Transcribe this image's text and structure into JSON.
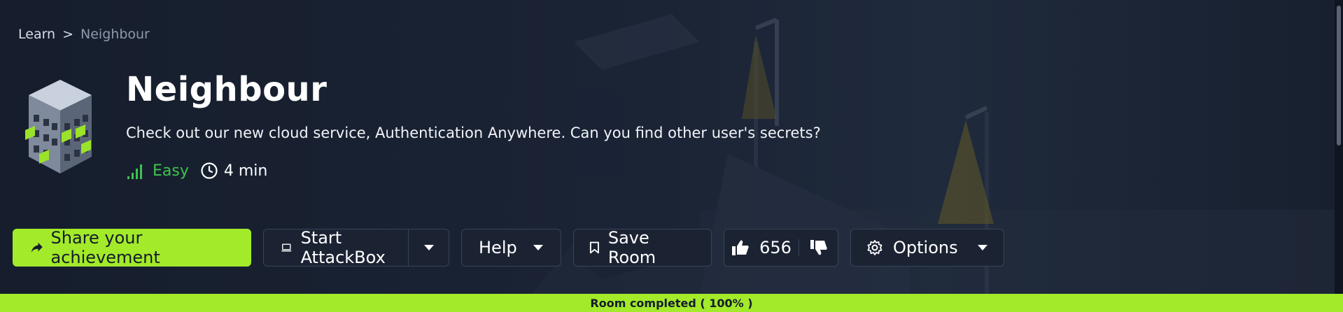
{
  "breadcrumb": {
    "root": "Learn",
    "separator": ">",
    "current": "Neighbour"
  },
  "room": {
    "title": "Neighbour",
    "description": "Check out our new cloud service, Authentication Anywhere. Can you find other user's secrets?",
    "difficulty": "Easy",
    "duration": "4 min",
    "icon": "building-icon"
  },
  "toolbar": {
    "share_label": "Share your achievement",
    "attackbox_label": "Start AttackBox",
    "help_label": "Help",
    "save_label": "Save Room",
    "upvotes": "656",
    "options_label": "Options"
  },
  "progress": {
    "label": "Room completed ( 100% )",
    "value": 1.0
  },
  "colors": {
    "accent": "#a3ea2a",
    "background": "#141c2b",
    "difficulty_easy": "#3ec24f"
  }
}
